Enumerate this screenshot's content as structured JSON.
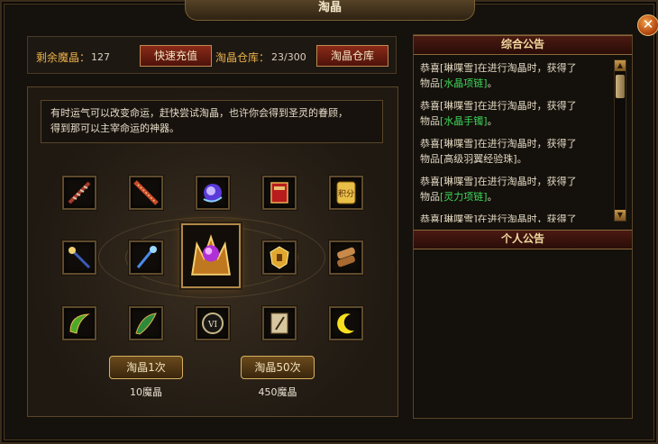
{
  "window": {
    "title": "淘晶"
  },
  "topbar": {
    "remaining_label": "剩余魔晶：",
    "remaining_value": "127",
    "recharge_button": "快速充值",
    "warehouse_label": "淘晶仓库：",
    "warehouse_value": "23/300",
    "warehouse_button": "淘晶仓库"
  },
  "description": {
    "line1": "有时运气可以改变命运，赶快尝试淘晶，也许你会得到圣灵的眷顾，",
    "line2": "得到那可以主宰命运的神器。"
  },
  "slots": {
    "row1": [
      "spine-blade-icon",
      "serrated-sword-icon",
      "purple-orb-icon",
      "red-tome-icon",
      "points-scroll-icon"
    ],
    "row2": [
      "crystal-staff-icon",
      "blue-staff-icon",
      "gold-emblem-icon",
      "scroll-bundle-icon"
    ],
    "row3": [
      "green-boomerang-icon",
      "green-blade-icon",
      "roman-six-dial-icon",
      "feather-note-icon",
      "yellow-moon-icon"
    ],
    "center": "amethyst-crown-icon",
    "points_text": "积分",
    "dial_text": "VI"
  },
  "actions": {
    "once_label": "淘晶1次",
    "once_cost": "10魔晶",
    "fifty_label": "淘晶50次",
    "fifty_cost": "450魔晶"
  },
  "announcements": {
    "global_title": "综合公告",
    "personal_title": "个人公告",
    "items": [
      {
        "prefix": "恭喜",
        "name": "[琳喋雪]",
        "mid": "在进行淘晶时，获得了",
        "line2": "物品",
        "item": "[水晶项链]",
        "end": "。"
      },
      {
        "prefix": "恭喜",
        "name": "[琳喋雪]",
        "mid": "在进行淘晶时，获得了",
        "line2": "物品",
        "item": "[水晶手镯]",
        "end": "。"
      },
      {
        "prefix": "恭喜",
        "name": "[琳喋雪]",
        "mid": "在进行淘晶时，获得了",
        "line2": "物品",
        "item": "[高级羽翼经验珠]",
        "end": "。"
      },
      {
        "prefix": "恭喜",
        "name": "[琳喋雪]",
        "mid": "在进行淘晶时，获得了",
        "line2": "物品",
        "item": "[灵力项链]",
        "end": "。"
      },
      {
        "prefix": "恭喜",
        "name": "[琳喋雪]",
        "mid": "在进行淘晶时，获得了",
        "line2": "",
        "item": "",
        "end": ""
      }
    ]
  },
  "colors": {
    "accent_gold": "#e8b04a",
    "item_green": "#3ed65a",
    "panel_border": "#5a4628"
  }
}
